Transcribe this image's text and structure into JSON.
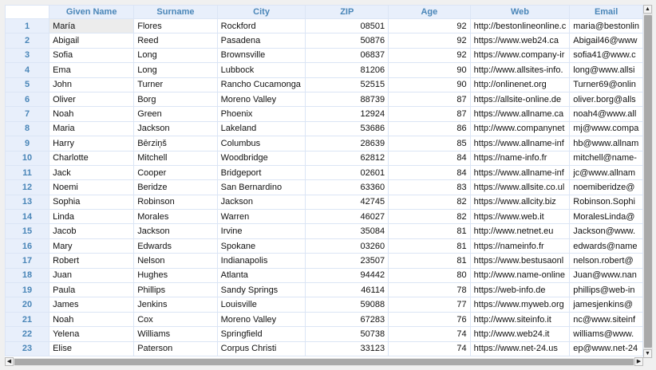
{
  "columns": [
    "Given Name",
    "Surname",
    "City",
    "ZIP",
    "Age",
    "Web",
    "Email"
  ],
  "selected_cell": {
    "row": 1,
    "column": "Given Name"
  },
  "rows": [
    [
      "1",
      "María",
      "Flores",
      "Rockford",
      "08501",
      "92",
      "http://bestonlineonline.c",
      "maria@bestonlin"
    ],
    [
      "2",
      "Abigail",
      "Reed",
      "Pasadena",
      "50876",
      "92",
      "https://www.web24.ca",
      "Abigail46@www"
    ],
    [
      "3",
      "Sofia",
      "Long",
      "Brownsville",
      "06837",
      "92",
      "https://www.company-ir",
      "sofia41@www.c"
    ],
    [
      "4",
      "Ema",
      "Long",
      "Lubbock",
      "81206",
      "90",
      "http://www.allsites-info.",
      "long@www.allsi"
    ],
    [
      "5",
      "John",
      "Turner",
      "Rancho Cucamonga",
      "52515",
      "90",
      "http://onlinenet.org",
      "Turner69@onlin"
    ],
    [
      "6",
      "Oliver",
      "Borg",
      "Moreno Valley",
      "88739",
      "87",
      "https://allsite-online.de",
      "oliver.borg@alls"
    ],
    [
      "7",
      "Noah",
      "Green",
      "Phoenix",
      "12924",
      "87",
      "https://www.allname.ca",
      "noah4@www.all"
    ],
    [
      "8",
      "Maria",
      "Jackson",
      "Lakeland",
      "53686",
      "86",
      "http://www.companynet",
      "mj@www.compa"
    ],
    [
      "9",
      "Harry",
      "Bērziņš",
      "Columbus",
      "28639",
      "85",
      "https://www.allname-inf",
      "hb@www.allnam"
    ],
    [
      "10",
      "Charlotte",
      "Mitchell",
      "Woodbridge",
      "62812",
      "84",
      "https://name-info.fr",
      "mitchell@name-"
    ],
    [
      "11",
      "Jack",
      "Cooper",
      "Bridgeport",
      "02601",
      "84",
      "https://www.allname-inf",
      "jc@www.allnam"
    ],
    [
      "12",
      "Noemi",
      "Beridze",
      "San Bernardino",
      "63360",
      "83",
      "https://www.allsite.co.ul",
      "noemiberidze@"
    ],
    [
      "13",
      "Sophia",
      "Robinson",
      "Jackson",
      "42745",
      "82",
      "https://www.allcity.biz",
      "Robinson.Sophi"
    ],
    [
      "14",
      "Linda",
      "Morales",
      "Warren",
      "46027",
      "82",
      "https://www.web.it",
      "MoralesLinda@"
    ],
    [
      "15",
      "Jacob",
      "Jackson",
      "Irvine",
      "35084",
      "81",
      "http://www.netnet.eu",
      "Jackson@www."
    ],
    [
      "16",
      "Mary",
      "Edwards",
      "Spokane",
      "03260",
      "81",
      "https://nameinfo.fr",
      "edwards@name"
    ],
    [
      "17",
      "Robert",
      "Nelson",
      "Indianapolis",
      "23507",
      "81",
      "https://www.bestusaonl",
      "nelson.robert@"
    ],
    [
      "18",
      "Juan",
      "Hughes",
      "Atlanta",
      "94442",
      "80",
      "http://www.name-online",
      "Juan@www.nan"
    ],
    [
      "19",
      "Paula",
      "Phillips",
      "Sandy Springs",
      "46114",
      "78",
      "https://web-info.de",
      "phillips@web-in"
    ],
    [
      "20",
      "James",
      "Jenkins",
      "Louisville",
      "59088",
      "77",
      "https://www.myweb.org",
      "jamesjenkins@"
    ],
    [
      "21",
      "Noah",
      "Cox",
      "Moreno Valley",
      "67283",
      "76",
      "http://www.siteinfo.it",
      "nc@www.siteinf"
    ],
    [
      "22",
      "Yelena",
      "Williams",
      "Springfield",
      "50738",
      "74",
      "http://www.web24.it",
      "williams@www."
    ],
    [
      "23",
      "Elise",
      "Paterson",
      "Corpus Christi",
      "33123",
      "74",
      "https://www.net-24.us",
      "ep@www.net-24"
    ]
  ]
}
